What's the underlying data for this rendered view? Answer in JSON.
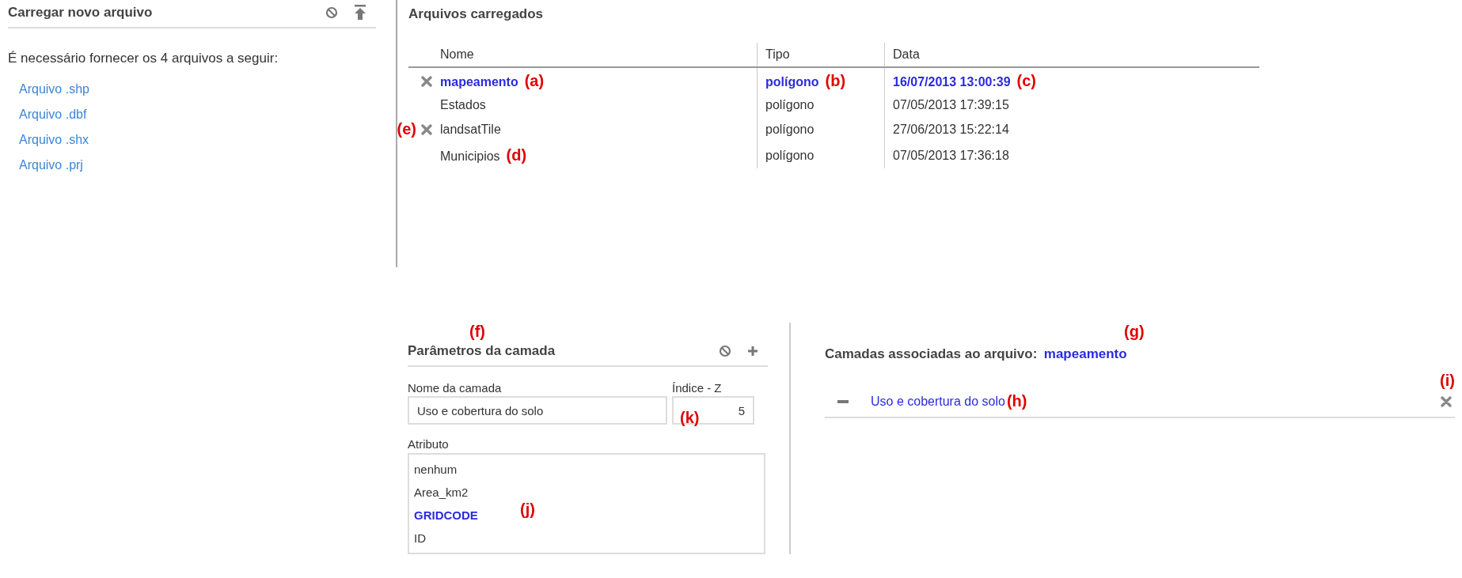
{
  "upload_panel": {
    "title": "Carregar novo arquivo",
    "instruction": "É necessário fornecer os 4 arquivos a seguir:",
    "files": [
      {
        "label": "Arquivo .shp"
      },
      {
        "label": "Arquivo .dbf"
      },
      {
        "label": "Arquivo .shx"
      },
      {
        "label": "Arquivo .prj"
      }
    ]
  },
  "loaded_files": {
    "title": "Arquivos carregados",
    "columns": [
      "Nome",
      "Tipo",
      "Data"
    ],
    "rows": [
      {
        "name": "mapeamento",
        "type": "polígono",
        "date": "16/07/2013 13:00:39",
        "selected": true,
        "removable": true,
        "name_note": "(a)",
        "type_note": "(b)",
        "date_note": "(c)"
      },
      {
        "name": "Estados",
        "type": "polígono",
        "date": "07/05/2013 17:39:15",
        "selected": false,
        "removable": false
      },
      {
        "name": "landsatTile",
        "type": "polígono",
        "date": "27/06/2013 15:22:14",
        "selected": false,
        "removable": true,
        "marker_note": "(e)"
      },
      {
        "name": "Municipios",
        "type": "polígono",
        "date": "07/05/2013 17:36:18",
        "selected": false,
        "removable": false,
        "name_note": "(d)"
      }
    ]
  },
  "layer_params": {
    "note": "(f)",
    "title": "Parâmetros da camada",
    "name_label": "Nome da camada",
    "name_value": "Uso e cobertura do solo",
    "z_label": "Índice - Z",
    "z_value": "5",
    "z_note": "(k)",
    "attribute_label": "Atributo",
    "attribute_note": "(j)",
    "attributes": [
      {
        "label": "nenhum",
        "selected": false
      },
      {
        "label": "Area_km2",
        "selected": false
      },
      {
        "label": "GRIDCODE",
        "selected": true
      },
      {
        "label": "ID",
        "selected": false
      }
    ]
  },
  "associated_layers": {
    "note": "(g)",
    "title": "Camadas associadas ao arquivo:",
    "file": "mapeamento",
    "remove_note": "(i)",
    "layers": [
      {
        "name": "Uso e cobertura do solo",
        "note": "(h)"
      }
    ]
  }
}
